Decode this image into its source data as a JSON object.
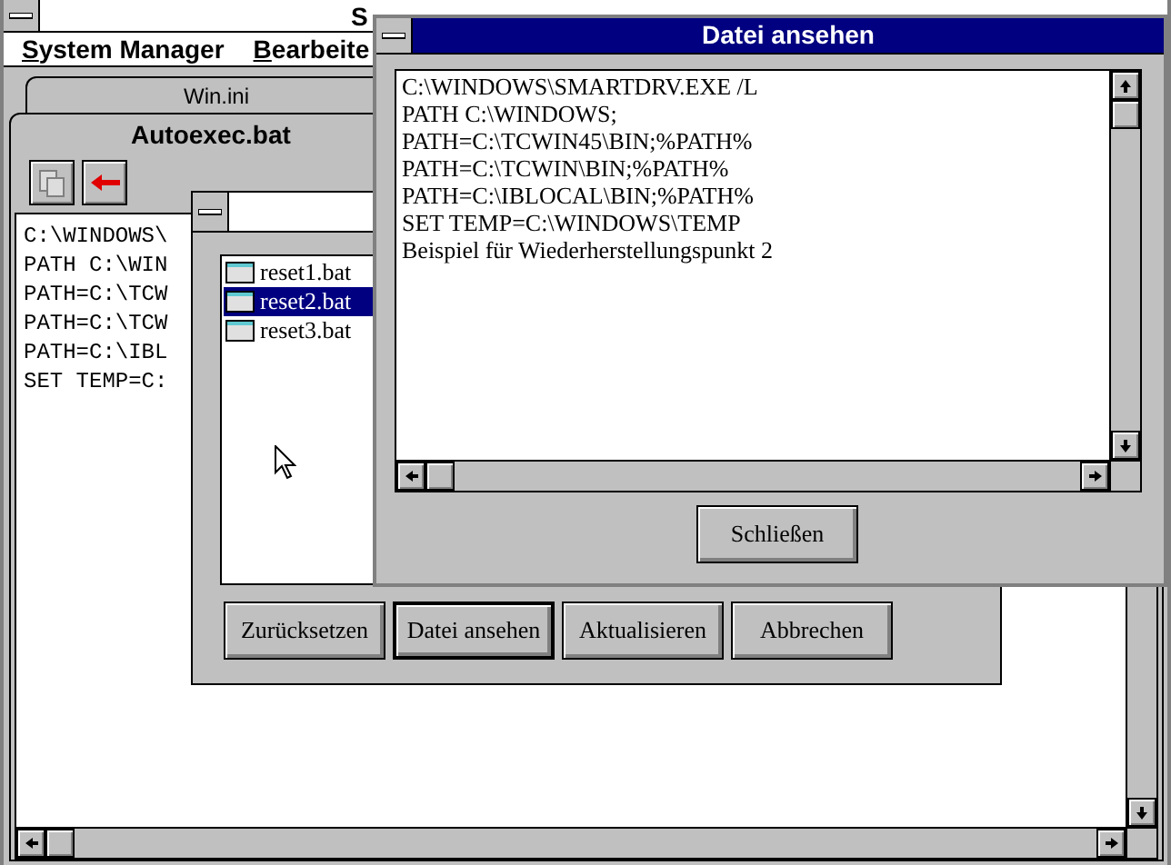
{
  "main_window": {
    "title": "S",
    "menu": [
      "System Manager",
      "Bearbeite"
    ]
  },
  "tabs": [
    {
      "label": "Win.ini",
      "selected": false
    },
    {
      "label": "Autoexec.bat",
      "selected": true
    }
  ],
  "editor": {
    "lines": [
      "C:\\WINDOWS\\",
      "PATH C:\\WIN",
      "PATH=C:\\TCW",
      "PATH=C:\\TCW",
      "PATH=C:\\IBL",
      "SET TEMP=C:"
    ]
  },
  "reset_dialog": {
    "files": [
      {
        "name": "reset1.bat",
        "selected": false
      },
      {
        "name": "reset2.bat",
        "selected": true
      },
      {
        "name": "reset3.bat",
        "selected": false
      }
    ],
    "buttons": [
      {
        "label": "Zurücksetzen",
        "default": false
      },
      {
        "label": "Datei ansehen",
        "default": true
      },
      {
        "label": "Aktualisieren",
        "default": false
      },
      {
        "label": "Abbrechen",
        "default": false
      }
    ]
  },
  "viewer": {
    "title": "Datei ansehen",
    "lines": [
      "C:\\WINDOWS\\SMARTDRV.EXE /L",
      "PATH C:\\WINDOWS;",
      "PATH=C:\\TCWIN45\\BIN;%PATH%",
      "PATH=C:\\TCWIN\\BIN;%PATH%",
      "PATH=C:\\IBLOCAL\\BIN;%PATH%",
      "SET TEMP=C:\\WINDOWS\\TEMP",
      "Beispiel für Wiederherstellungspunkt 2"
    ],
    "button": "Schließen"
  }
}
